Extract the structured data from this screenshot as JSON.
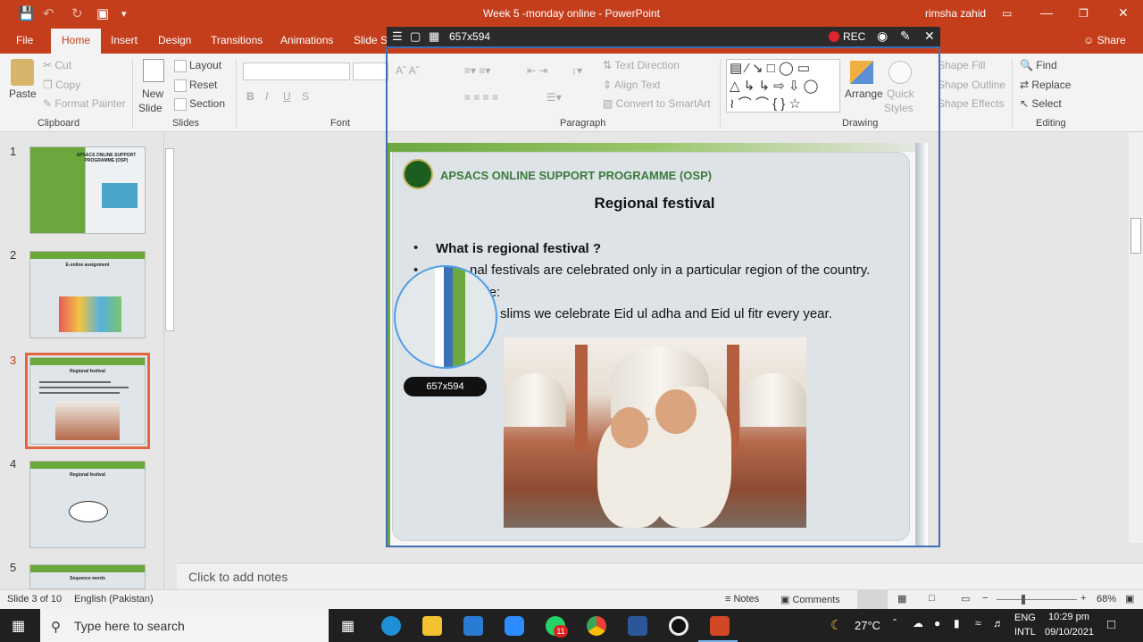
{
  "titlebar": {
    "doc_title": "Week 5 -monday online  -  PowerPoint",
    "user": "rimsha zahid"
  },
  "tabs": [
    {
      "label": "File"
    },
    {
      "label": "Home"
    },
    {
      "label": "Insert"
    },
    {
      "label": "Design"
    },
    {
      "label": "Transitions"
    },
    {
      "label": "Animations"
    },
    {
      "label": "Slide Sh"
    }
  ],
  "share_label": "Share",
  "ribbon": {
    "clipboard": {
      "paste": "Paste",
      "cut": "Cut",
      "copy": "Copy",
      "format_painter": "Format Painter",
      "label": "Clipboard"
    },
    "slides": {
      "new_slide": "New",
      "new_slide2": "Slide",
      "layout": "Layout",
      "reset": "Reset",
      "section": "Section",
      "label": "Slides"
    },
    "font": {
      "label": "Font"
    },
    "paragraph": {
      "text_direction": "Text Direction",
      "align_text": "Align Text",
      "convert_smartart": "Convert to SmartArt",
      "label": "Paragraph"
    },
    "drawing": {
      "arrange": "Arrange",
      "quick": "Quick",
      "styles": "Styles",
      "shape_fill": "Shape Fill",
      "shape_outline": "Shape Outline",
      "shape_effects": "Shape Effects",
      "label": "Drawing"
    },
    "editing": {
      "find": "Find",
      "replace": "Replace",
      "select": "Select",
      "label": "Editing"
    }
  },
  "capture": {
    "size_label": "657x594",
    "rec_label": "REC",
    "dim_label": "657x594"
  },
  "thumbnails": [
    {
      "num": "1",
      "title": "APSACS ONLINE SUPPORT PROGRAMME (OSP)"
    },
    {
      "num": "2",
      "title": "E-online assignment"
    },
    {
      "num": "3",
      "title": "Regional festival"
    },
    {
      "num": "4",
      "title": "Regional festival"
    },
    {
      "num": "5",
      "title": "Sequence words"
    }
  ],
  "slide": {
    "org": "APSACS ONLINE SUPPORT PROGRAMME (OSP)",
    "title": "Regional festival",
    "q": "What is regional festival ?",
    "line1": "nal festivals are celebrated only in a particular region of the country.",
    "line2": "ple:",
    "line3": "slims we celebrate Eid ul adha and Eid ul fitr every year."
  },
  "notes_placeholder": "Click to add notes",
  "status": {
    "slide": "Slide 3 of 10",
    "lang": "English (Pakistan)",
    "notes": "Notes",
    "comments": "Comments",
    "zoom": "68%"
  },
  "taskbar": {
    "search": "Type here to search",
    "whatsapp_badge": "11",
    "weather": "27°C",
    "lang1": "ENG",
    "lang2": "INTL",
    "time": "10:29 pm",
    "date": "09/10/2021"
  }
}
